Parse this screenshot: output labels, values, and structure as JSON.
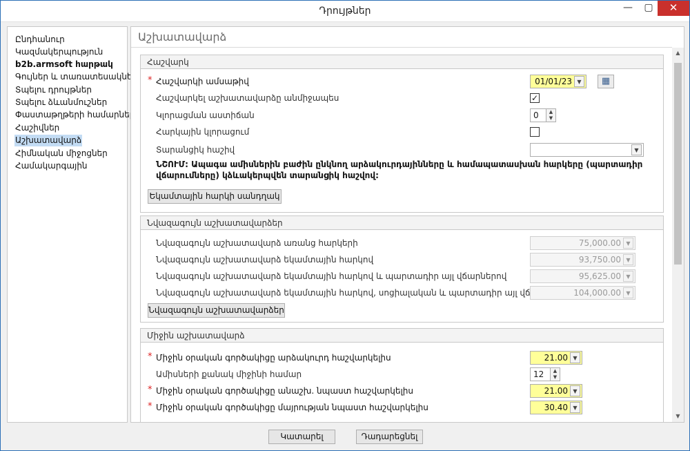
{
  "window": {
    "title": "Դրույթներ"
  },
  "sidebar": {
    "items": [
      {
        "label": "Ընդհանուր",
        "bold": false,
        "selected": false
      },
      {
        "label": "Կազմակերպություն",
        "bold": false,
        "selected": false
      },
      {
        "label": "b2b.armsoft հարթակ",
        "bold": true,
        "selected": false
      },
      {
        "label": "Գույներ և տառատեսակներ",
        "bold": false,
        "selected": false
      },
      {
        "label": "Տպելու դրույթներ",
        "bold": false,
        "selected": false
      },
      {
        "label": "Տպելու ձևանմուշներ",
        "bold": false,
        "selected": false
      },
      {
        "label": "Փաստաթղթերի համարներ",
        "bold": false,
        "selected": false
      },
      {
        "label": "Հաշիվներ",
        "bold": false,
        "selected": false
      },
      {
        "label": "Աշխատավարձ",
        "bold": false,
        "selected": true
      },
      {
        "label": "Հիմնական միջոցներ",
        "bold": false,
        "selected": false
      },
      {
        "label": "Համակարգային",
        "bold": false,
        "selected": false
      }
    ]
  },
  "main": {
    "heading": "Աշխատավարձ",
    "calc": {
      "header": "Հաշվարկ",
      "date_label": "Հաշվարկի ամսաթիվ",
      "date_value": "01/01/23",
      "auto_calc_label": "Հաշվարկել աշխատավարձը անմիջապես",
      "auto_calc_checked": "✓",
      "rounding_label": "Կլորացման աստիճան",
      "rounding_value": "0",
      "tax_round_label": "Հարկային կլորացում",
      "transit_label": "Տարանցիկ հաշիվ",
      "transit_value": "",
      "note": "ՆՇՈՒՄ: Ապագա ամիսներին բաժին ընկնող արձակուրդայինները և համապատասխան հարկերը (պարտադիր վճարումները) կձևակերպվեն տարանցիկ հաշվով:",
      "income_tax_btn": "Եկամտային հարկի սանդղակ"
    },
    "minwage": {
      "header": "Նվազագույն աշխատավարձեր",
      "rows": [
        {
          "label": "Նվազագույն աշխատավարձ առանց հարկերի",
          "value": "75,000.00"
        },
        {
          "label": "Նվազագույն աշխատավարձ եկամտային հարկով",
          "value": "93,750.00"
        },
        {
          "label": "Նվազագույն աշխատավարձ եկամտային հարկով և պարտադիր այլ վճարներով",
          "value": "95,625.00"
        },
        {
          "label": "Նվազագույն աշխատավարձ եկամտային հարկով, սոցիալական և պարտադիր այլ վճարներով",
          "value": "104,000.00"
        }
      ],
      "button": "Նվազագույն աշխատավարձեր"
    },
    "avg": {
      "header": "Միջին աշխատավարձ",
      "rows": [
        {
          "label": "Միջին օրական գործակիցը արձակուրդ հաշվարկելիս",
          "value": "21.00",
          "required": "*"
        },
        {
          "label": "Ամիսների քանակ միջինի համար",
          "value": "12",
          "required": ""
        },
        {
          "label": "Միջին օրական գործակիցը անաշխ. նպաստ հաշվարկելիս",
          "value": "21.00",
          "required": "*"
        },
        {
          "label": "Միջին օրական գործակիցը մայրության նպաստ հաշվարկելիս",
          "value": "30.40",
          "required": "*"
        }
      ]
    }
  },
  "footer": {
    "ok": "Կատարել",
    "cancel": "Դադարեցնել"
  },
  "icons": {
    "minimize": "minimize-icon",
    "maximize": "maximize-icon",
    "close": "close-icon",
    "calendar": "calendar-icon",
    "dropdown": "chevron-down-icon"
  },
  "colors": {
    "required_bg": "#ffff99",
    "selected_nav": "#c3dcf4",
    "close_button": "#c9302c"
  }
}
